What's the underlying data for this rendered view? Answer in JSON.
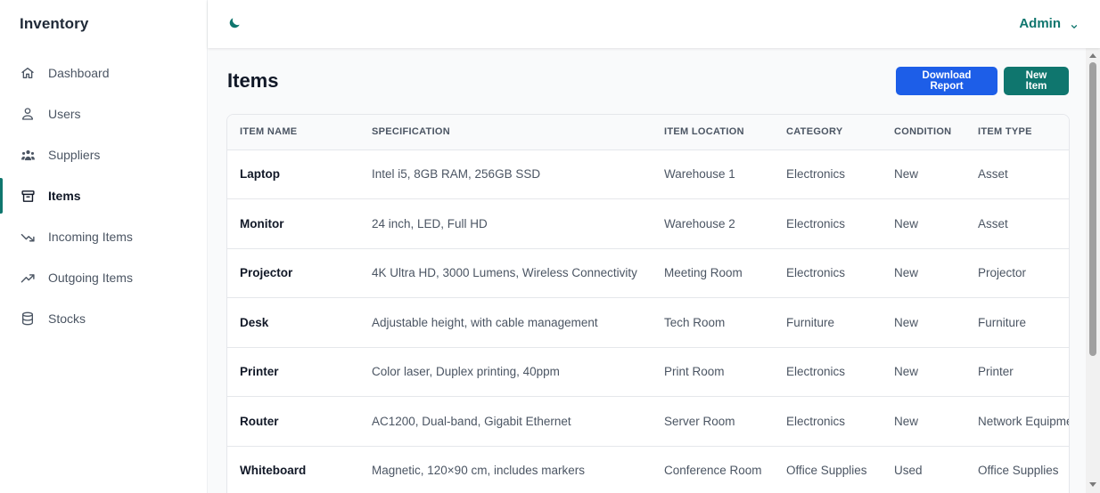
{
  "app": {
    "title": "Inventory"
  },
  "sidebar": {
    "items": [
      {
        "label": "Dashboard",
        "icon": "home-icon"
      },
      {
        "label": "Users",
        "icon": "user-icon"
      },
      {
        "label": "Suppliers",
        "icon": "users-group-icon"
      },
      {
        "label": "Items",
        "icon": "archive-box-icon",
        "active": true
      },
      {
        "label": "Incoming Items",
        "icon": "trend-down-icon"
      },
      {
        "label": "Outgoing Items",
        "icon": "trend-up-icon"
      },
      {
        "label": "Stocks",
        "icon": "database-icon"
      }
    ]
  },
  "topbar": {
    "theme_icon": "moon-icon",
    "user_label": "Admin",
    "user_icon": "chevron-down-icon"
  },
  "main": {
    "page_title": "Items",
    "download_label": "Download Report",
    "new_label": "New Item"
  },
  "table": {
    "columns": [
      "ITEM NAME",
      "SPECIFICATION",
      "ITEM LOCATION",
      "CATEGORY",
      "CONDITION",
      "ITEM TYPE"
    ],
    "rows": [
      [
        "Laptop",
        "Intel i5, 8GB RAM, 256GB SSD",
        "Warehouse 1",
        "Electronics",
        "New",
        "Asset"
      ],
      [
        "Monitor",
        "24 inch, LED, Full HD",
        "Warehouse 2",
        "Electronics",
        "New",
        "Asset"
      ],
      [
        "Projector",
        "4K Ultra HD, 3000 Lumens, Wireless Connectivity",
        "Meeting Room",
        "Electronics",
        "New",
        "Projector"
      ],
      [
        "Desk",
        "Adjustable height, with cable management",
        "Tech Room",
        "Furniture",
        "New",
        "Furniture"
      ],
      [
        "Printer",
        "Color laser, Duplex printing, 40ppm",
        "Print Room",
        "Electronics",
        "New",
        "Printer"
      ],
      [
        "Router",
        "AC1200, Dual-band, Gigabit Ethernet",
        "Server Room",
        "Electronics",
        "New",
        "Network Equipment"
      ],
      [
        "Whiteboard",
        "Magnetic, 120×90 cm, includes markers",
        "Conference Room",
        "Office Supplies",
        "Used",
        "Office Supplies"
      ]
    ]
  },
  "colors": {
    "accent": "#0f766e",
    "primary_button": "#1d5ee8"
  }
}
